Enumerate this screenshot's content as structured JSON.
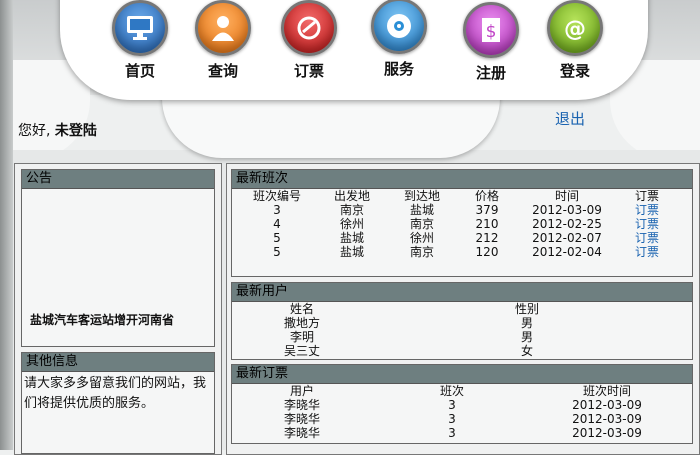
{
  "nav": [
    {
      "label": "首页",
      "icon": "monitor-icon",
      "color": "#2f78c4"
    },
    {
      "label": "查询",
      "icon": "person-icon",
      "color": "#f07a14"
    },
    {
      "label": "订票",
      "icon": "ticket-icon",
      "color": "#d42020"
    },
    {
      "label": "服务",
      "icon": "disc-icon",
      "color": "#2a8fd6"
    },
    {
      "label": "注册",
      "icon": "dollar-doc-icon",
      "color": "#c044c7"
    },
    {
      "label": "登录",
      "icon": "at-icon",
      "color": "#7cb622"
    }
  ],
  "user": {
    "greeting": "您好,",
    "status": "未登陆",
    "logout": "退出"
  },
  "announcement": {
    "title": "公告",
    "text": "盐城汽车客运站增开河南省"
  },
  "other_info": {
    "title": "其他信息",
    "text": "请大家多多留意我们的网站，我们将提供优质的服务。"
  },
  "latest_trips": {
    "title": "最新班次",
    "headers": [
      "班次编号",
      "出发地",
      "到达地",
      "价格",
      "时间",
      "订票"
    ],
    "rows": [
      [
        "3",
        "南京",
        "盐城",
        "379",
        "2012-03-09",
        "订票"
      ],
      [
        "4",
        "徐州",
        "南京",
        "210",
        "2012-02-25",
        "订票"
      ],
      [
        "5",
        "盐城",
        "徐州",
        "212",
        "2012-02-07",
        "订票"
      ],
      [
        "5",
        "盐城",
        "南京",
        "120",
        "2012-02-04",
        "订票"
      ]
    ]
  },
  "latest_users": {
    "title": "最新用户",
    "headers": [
      "姓名",
      "性别"
    ],
    "rows": [
      [
        "撒地方",
        "男"
      ],
      [
        "李明",
        "男"
      ],
      [
        "吴三丈",
        "女"
      ]
    ]
  },
  "latest_orders": {
    "title": "最新订票",
    "headers": [
      "用户",
      "班次",
      "班次时间"
    ],
    "rows": [
      [
        "李晓华",
        "3",
        "2012-03-09"
      ],
      [
        "李晓华",
        "3",
        "2012-03-09"
      ],
      [
        "李晓华",
        "3",
        "2012-03-09"
      ]
    ]
  }
}
